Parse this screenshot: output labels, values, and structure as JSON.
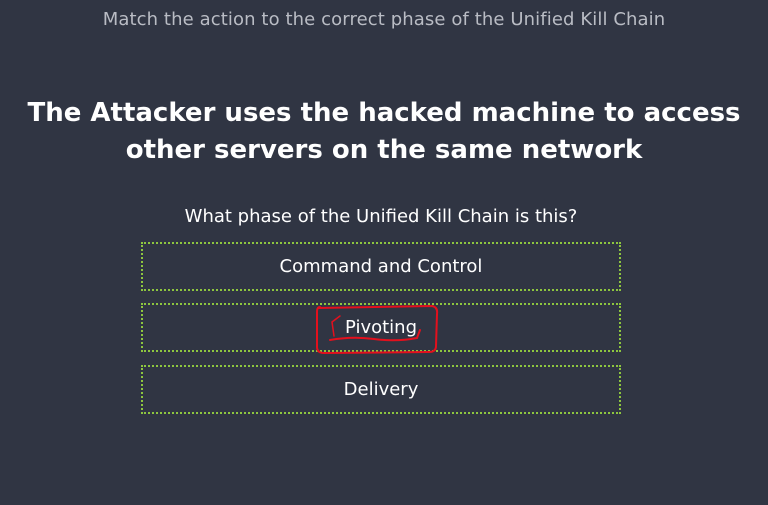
{
  "instruction": "Match the action to the correct phase of the Unified Kill Chain",
  "scenario": "The Attacker uses the hacked machine to access other servers on the same network",
  "question": "What phase of the Unified Kill Chain is this?",
  "options": [
    {
      "label": "Command and Control"
    },
    {
      "label": "Pivoting"
    },
    {
      "label": "Delivery"
    }
  ],
  "colors": {
    "background": "#303543",
    "option_border": "#8dc63f",
    "annotation": "#e3101d"
  }
}
